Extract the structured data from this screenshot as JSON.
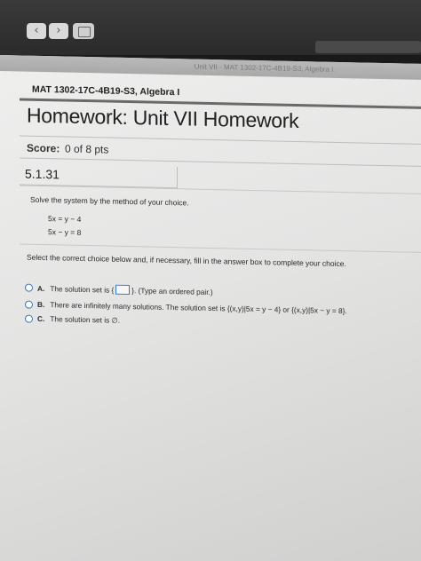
{
  "browser": {
    "back_glyph": "‹",
    "forward_glyph": "›",
    "tab_title": "Unit VII - MAT 1302-17C-4B19-S3, Algebra I"
  },
  "course": {
    "title": "MAT 1302-17C-4B19-S3, Algebra I"
  },
  "homework": {
    "title": "Homework: Unit VII Homework",
    "score_label": "Score:",
    "score_value": "0 of 8 pts"
  },
  "question": {
    "number": "5.1.31",
    "instruction": "Solve the system by the method of your choice.",
    "equations": [
      "5x = y − 4",
      "5x − y = 8"
    ],
    "select_prompt": "Select the correct choice below and, if necessary, fill in the answer box to complete your choice.",
    "choices": [
      {
        "letter": "A.",
        "text_before": "The solution set is {",
        "text_after": "}. (Type an ordered pair.)"
      },
      {
        "letter": "B.",
        "text": "There are infinitely many solutions. The solution set is {(x,y)|5x = y − 4} or {(x,y)|5x − y = 8}."
      },
      {
        "letter": "C.",
        "text": "The solution set is ∅."
      }
    ]
  }
}
